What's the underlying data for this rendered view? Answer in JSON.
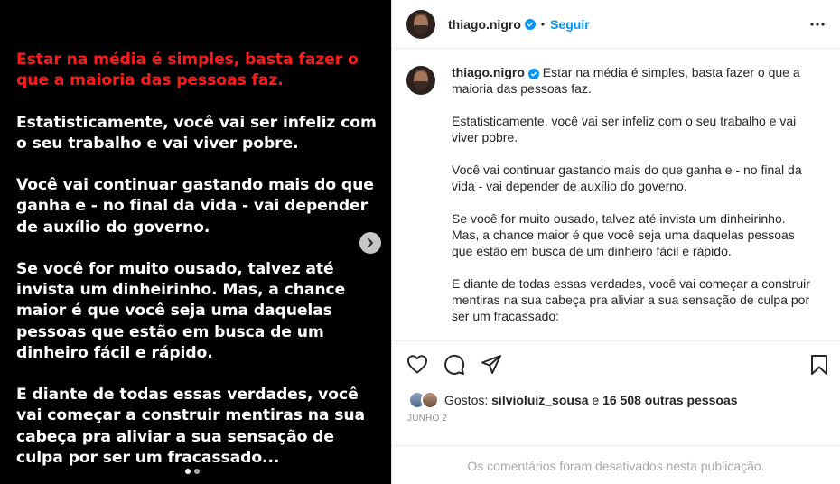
{
  "post_image": {
    "paragraphs": [
      "Estar na média é simples, basta fazer o que a maioria das pessoas faz.",
      "Estatisticamente, você vai ser infeliz com o seu trabalho e vai viver pobre.",
      "Você vai continuar gastando mais do que ganha e - no final da vida - vai depender de auxílio do governo.",
      "Se você for muito ousado, talvez até invista um dinheirinho. Mas, a chance maior é que você seja uma daquelas pessoas que estão em busca de um dinheiro fácil e rápido.",
      "E diante de todas essas verdades, você vai começar a construir mentiras na sua cabeça pra aliviar a sua sensação de culpa por ser um fracassado..."
    ],
    "highlight_color": "#ff1a1a",
    "carousel_count": 2,
    "carousel_active": 1
  },
  "header": {
    "username": "thiago.nigro",
    "separator": "•",
    "follow_label": "Seguir"
  },
  "caption": {
    "username": "thiago.nigro",
    "first_line": "Estar na média é simples, basta fazer o que a maioria das pessoas faz.",
    "paragraphs": [
      "Estatisticamente, você vai ser infeliz com o seu trabalho e vai viver pobre.",
      "Você vai continuar gastando mais do que ganha e - no final da vida - vai depender de auxílio do governo.",
      "Se você for muito ousado, talvez até invista um dinheirinho. Mas, a chance maior é que você seja uma daquelas pessoas que estão em busca de um dinheiro fácil e rápido.",
      "E diante de todas essas verdades, você vai começar a construir mentiras na sua cabeça pra aliviar a sua sensação de culpa por ser um fracassado:"
    ]
  },
  "likes": {
    "prefix": "Gostos: ",
    "user": "silvioluiz_sousa",
    "middle": " e ",
    "others": "16 508 outras pessoas"
  },
  "date": "JUNHO 2",
  "comments_disabled": "Os comentários foram desativados nesta publicação.",
  "colors": {
    "accent": "#0095f6",
    "verified": "#0095f6"
  }
}
